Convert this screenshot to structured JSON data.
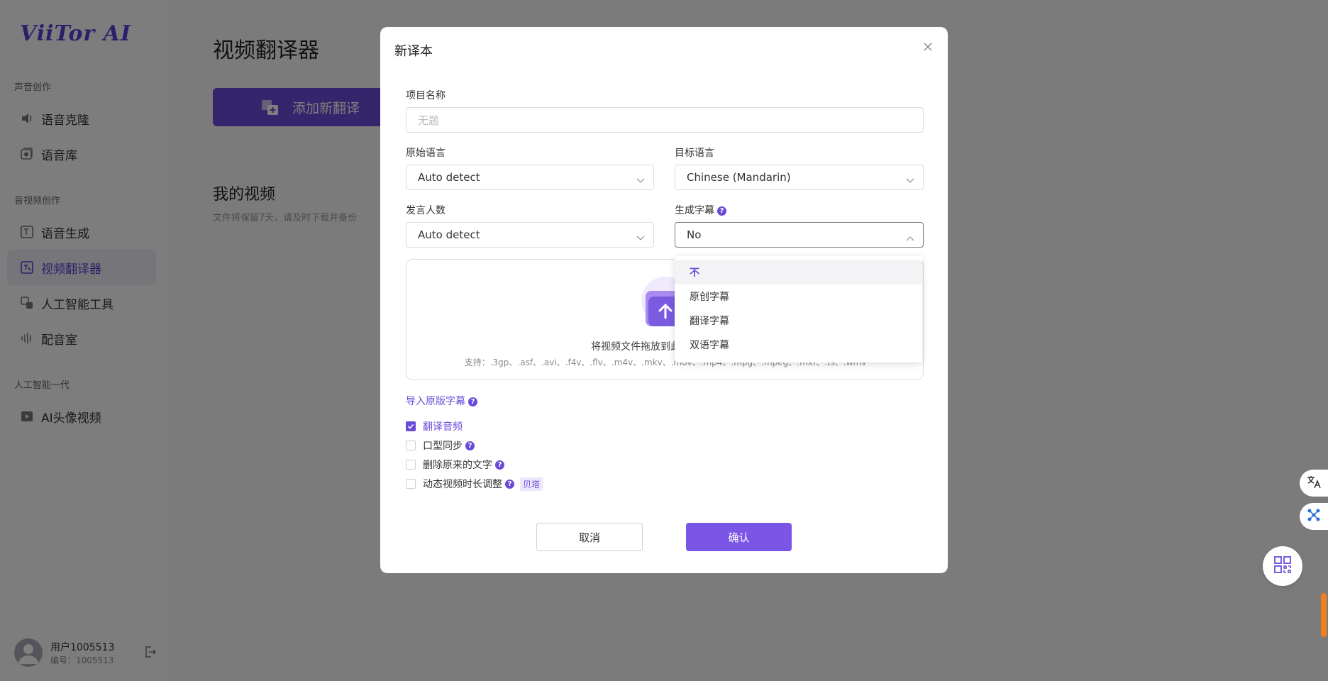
{
  "app": {
    "logo": "ViiTor AI"
  },
  "sidebar": {
    "sections": [
      {
        "label": "声音创作"
      },
      {
        "label": "音视频创作"
      },
      {
        "label": "人工智能一代"
      }
    ],
    "items": [
      {
        "label": "语音克隆",
        "icon": "speaker-icon"
      },
      {
        "label": "语音库",
        "icon": "voice-library-icon"
      },
      {
        "label": "语音生成",
        "icon": "text-to-speech-icon"
      },
      {
        "label": "视频翻译器",
        "icon": "video-translate-icon",
        "active": true
      },
      {
        "label": "人工智能工具",
        "icon": "ai-tools-icon"
      },
      {
        "label": "配音室",
        "icon": "waveform-icon"
      },
      {
        "label": "AI头像视频",
        "icon": "avatar-video-icon"
      }
    ],
    "user": {
      "name": "用户1005513",
      "id": "编号：1005513"
    }
  },
  "main": {
    "title": "视频翻译器",
    "add_button": "添加新翻译",
    "videos_title": "我的视频",
    "videos_note": "文件将保留7天，请及时下载并备份"
  },
  "modal": {
    "title": "新译本",
    "project_name_label": "项目名称",
    "project_name_placeholder": "无题",
    "source_lang_label": "原始语言",
    "source_lang_value": "Auto detect",
    "target_lang_label": "目标语言",
    "target_lang_value": "Chinese (Mandarin)",
    "speakers_label": "发言人数",
    "speakers_value": "Auto detect",
    "subtitles_label": "生成字幕",
    "subtitles_value": "No",
    "upload_text": "将视频文件拖放到此处或浏览文件",
    "upload_formats": "支持：.3gp、.asf、.avi、.f4v、.flv、.m4v、.mkv、.mov、.mp4、.mpg、.mpeg、.mxf、.ts、.wmv",
    "import_subtitles": "导入原版字幕",
    "options": [
      {
        "label": "翻译音频",
        "checked": true,
        "help": false,
        "beta": ""
      },
      {
        "label": "口型同步",
        "checked": false,
        "help": true,
        "beta": ""
      },
      {
        "label": "删除原来的文字",
        "checked": false,
        "help": true,
        "beta": ""
      },
      {
        "label": "动态视频时长调整",
        "checked": false,
        "help": true,
        "beta": "贝塔"
      }
    ],
    "cancel": "取消",
    "confirm": "确认"
  },
  "dropdown": {
    "options": [
      "不",
      "原创字幕",
      "翻译字幕",
      "双语字幕"
    ],
    "selected_index": 0
  },
  "colors": {
    "accent": "#6a4bd8",
    "orange": "#f07f1e"
  }
}
